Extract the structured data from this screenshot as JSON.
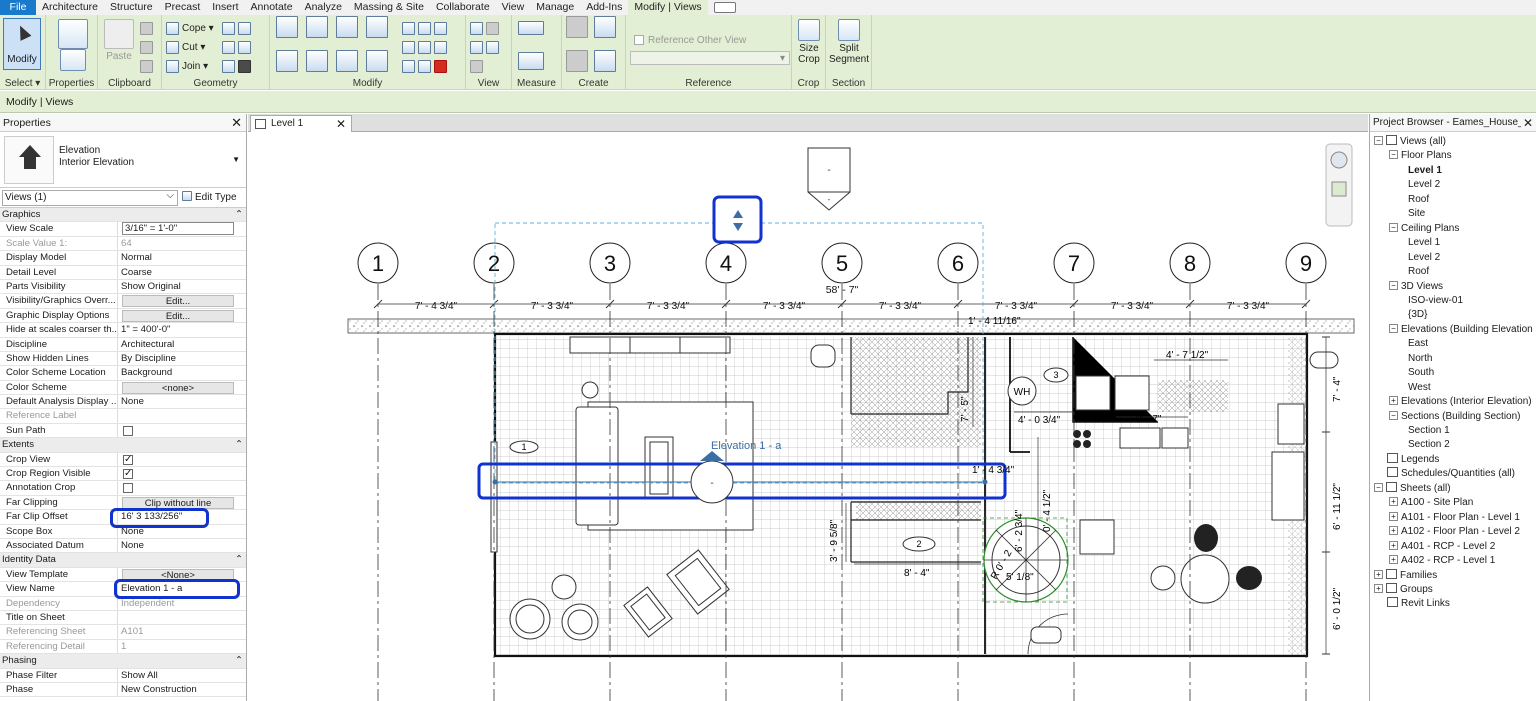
{
  "menu": {
    "tabs": [
      "File",
      "Architecture",
      "Structure",
      "Precast",
      "Insert",
      "Annotate",
      "Analyze",
      "Massing & Site",
      "Collaborate",
      "View",
      "Manage",
      "Add-Ins",
      "Modify | Views"
    ],
    "active": "Modify | Views"
  },
  "ribbon": {
    "panels": {
      "select": "Select ▾",
      "properties": "Properties",
      "clipboard": "Clipboard",
      "geometry": "Geometry",
      "modify": "Modify",
      "view": "View",
      "measure": "Measure",
      "create": "Create",
      "reference": "Reference",
      "crop": "Crop",
      "section": "Section"
    },
    "buttons": {
      "modify": "Modify",
      "paste": "Paste",
      "cope": "Cope",
      "cut": "Cut",
      "join": "Join",
      "reference_other_view": "Reference Other View",
      "size_crop": "Size\nCrop",
      "size_crop_l1": "Size",
      "size_crop_l2": "Crop",
      "split_segment_l1": "Split",
      "split_segment_l2": "Segment"
    }
  },
  "context_bar": "Modify | Views",
  "properties": {
    "title": "Properties",
    "type_family": "Elevation",
    "type_name": "Interior Elevation",
    "selector": "Views (1)",
    "edit_type": "Edit Type",
    "rows": [
      {
        "type": "section",
        "label": "Graphics"
      },
      {
        "label": "View Scale",
        "value": "3/16\" = 1'-0\"",
        "kind": "input"
      },
      {
        "label": "Scale Value    1:",
        "value": "64",
        "dim": true
      },
      {
        "label": "Display Model",
        "value": "Normal"
      },
      {
        "label": "Detail Level",
        "value": "Coarse"
      },
      {
        "label": "Parts Visibility",
        "value": "Show Original"
      },
      {
        "label": "Visibility/Graphics Overr...",
        "value": "Edit...",
        "kind": "button"
      },
      {
        "label": "Graphic Display Options",
        "value": "Edit...",
        "kind": "button"
      },
      {
        "label": "Hide at scales coarser th...",
        "value": "1\" = 400'-0\""
      },
      {
        "label": "Discipline",
        "value": "Architectural"
      },
      {
        "label": "Show Hidden Lines",
        "value": "By Discipline"
      },
      {
        "label": "Color Scheme Location",
        "value": "Background"
      },
      {
        "label": "Color Scheme",
        "value": "<none>",
        "kind": "button"
      },
      {
        "label": "Default Analysis Display ...",
        "value": "None"
      },
      {
        "label": "Reference Label",
        "value": "",
        "dim": true
      },
      {
        "label": "Sun Path",
        "value": "",
        "kind": "check",
        "checked": false
      },
      {
        "type": "section",
        "label": "Extents"
      },
      {
        "label": "Crop View",
        "value": "",
        "kind": "check",
        "checked": true
      },
      {
        "label": "Crop Region Visible",
        "value": "",
        "kind": "check",
        "checked": true
      },
      {
        "label": "Annotation Crop",
        "value": "",
        "kind": "check",
        "checked": false
      },
      {
        "label": "Far Clipping",
        "value": "Clip without line",
        "kind": "button"
      },
      {
        "label": "Far Clip Offset",
        "value": "16'  3 133/256\""
      },
      {
        "label": "Scope Box",
        "value": "None"
      },
      {
        "label": "Associated Datum",
        "value": "None"
      },
      {
        "type": "section",
        "label": "Identity Data"
      },
      {
        "label": "View Template",
        "value": "<None>",
        "kind": "button"
      },
      {
        "label": "View Name",
        "value": "Elevation 1 - a"
      },
      {
        "label": "Dependency",
        "value": "Independent",
        "dim": true
      },
      {
        "label": "Title on Sheet",
        "value": ""
      },
      {
        "label": "Referencing Sheet",
        "value": "A101",
        "dim": true
      },
      {
        "label": "Referencing Detail",
        "value": "1",
        "dim": true
      },
      {
        "type": "section",
        "label": "Phasing"
      },
      {
        "label": "Phase Filter",
        "value": "Show All"
      },
      {
        "label": "Phase",
        "value": "New Construction"
      }
    ]
  },
  "view_tab": {
    "label": "Level 1"
  },
  "drawing": {
    "grids": [
      "1",
      "2",
      "3",
      "4",
      "5",
      "6",
      "7",
      "8",
      "9"
    ],
    "overall_dim": "58' - 7\"",
    "bay_dims": [
      "7' - 4 3/4\"",
      "7' - 3 3/4\"",
      "7' - 3 3/4\"",
      "7' - 3 3/4\"",
      "7' - 3 3/4\"",
      "7' - 3 3/4\"",
      "7' - 3 3/4\"",
      "7' - 3 3/4\""
    ],
    "labels": {
      "elevation": "Elevation 1 - a",
      "wh": "WH",
      "tag1": "1",
      "tag2": "2",
      "tag3": "3",
      "d_1_4_11_16": "1' - 4 11/16\"",
      "d_4_7_1_2": "4' - 7 1/2\"",
      "d_4_0_3_4": "4' - 0 3/4\"",
      "d_9_7": "9' - 7\"",
      "d_7_5": "7' - 5\"",
      "d_1_4_3_4": "1' - 4 3/4\"",
      "d_3_9_5_8": "3' - 9 5/8\"",
      "d_8_4": "8' - 4\"",
      "d_0_4_1_2": "0' - 4 1/2\"",
      "d_6_2_3_4": "6' - 2 3/4\"",
      "d_5_1_8": "5' 1/8\"",
      "d_r": "R 0' - 2",
      "d_7_4": "7' - 4\"",
      "d_6_11_1_2": "6' - 11 1/2\"",
      "d_6_0_1_2": "6' - 0 1/2\"",
      "marker_dash": "-",
      "marker_dash_small": "-"
    }
  },
  "project_browser": {
    "title": "Project Browser - Eames_House_...",
    "items": [
      {
        "label": "Views (all)",
        "level": 0,
        "toggle": "-",
        "icon": true
      },
      {
        "label": "Floor Plans",
        "level": 1,
        "toggle": "-"
      },
      {
        "label": "Level 1",
        "level": 2,
        "bold": true
      },
      {
        "label": "Level 2",
        "level": 2
      },
      {
        "label": "Roof",
        "level": 2
      },
      {
        "label": "Site",
        "level": 2
      },
      {
        "label": "Ceiling Plans",
        "level": 1,
        "toggle": "-"
      },
      {
        "label": "Level 1",
        "level": 2
      },
      {
        "label": "Level 2",
        "level": 2
      },
      {
        "label": "Roof",
        "level": 2
      },
      {
        "label": "3D Views",
        "level": 1,
        "toggle": "-"
      },
      {
        "label": "ISO-view-01",
        "level": 2
      },
      {
        "label": "{3D}",
        "level": 2
      },
      {
        "label": "Elevations (Building Elevation",
        "level": 1,
        "toggle": "-"
      },
      {
        "label": "East",
        "level": 2
      },
      {
        "label": "North",
        "level": 2
      },
      {
        "label": "South",
        "level": 2
      },
      {
        "label": "West",
        "level": 2
      },
      {
        "label": "Elevations (Interior Elevation)",
        "level": 1,
        "toggle": "+"
      },
      {
        "label": "Sections (Building Section)",
        "level": 1,
        "toggle": "-"
      },
      {
        "label": "Section 1",
        "level": 2
      },
      {
        "label": "Section 2",
        "level": 2
      },
      {
        "label": "Legends",
        "level": 0,
        "icon": true
      },
      {
        "label": "Schedules/Quantities (all)",
        "level": 0,
        "icon": true
      },
      {
        "label": "Sheets (all)",
        "level": 0,
        "toggle": "-",
        "icon": true
      },
      {
        "label": "A100 - Site Plan",
        "level": 1,
        "toggle": "+"
      },
      {
        "label": "A101 - Floor Plan - Level 1",
        "level": 1,
        "toggle": "+"
      },
      {
        "label": "A102 - Floor Plan - Level 2",
        "level": 1,
        "toggle": "+"
      },
      {
        "label": "A401 - RCP - Level 2",
        "level": 1,
        "toggle": "+"
      },
      {
        "label": "A402 - RCP - Level 1",
        "level": 1,
        "toggle": "+"
      },
      {
        "label": "Families",
        "level": 0,
        "toggle": "+",
        "icon": true
      },
      {
        "label": "Groups",
        "level": 0,
        "toggle": "+",
        "icon": true
      },
      {
        "label": "Revit Links",
        "level": 0,
        "icon": true
      }
    ]
  },
  "colors": {
    "accent": "#1033cf",
    "ribbon": "#e3efd4",
    "file_tab": "#1979ca"
  }
}
